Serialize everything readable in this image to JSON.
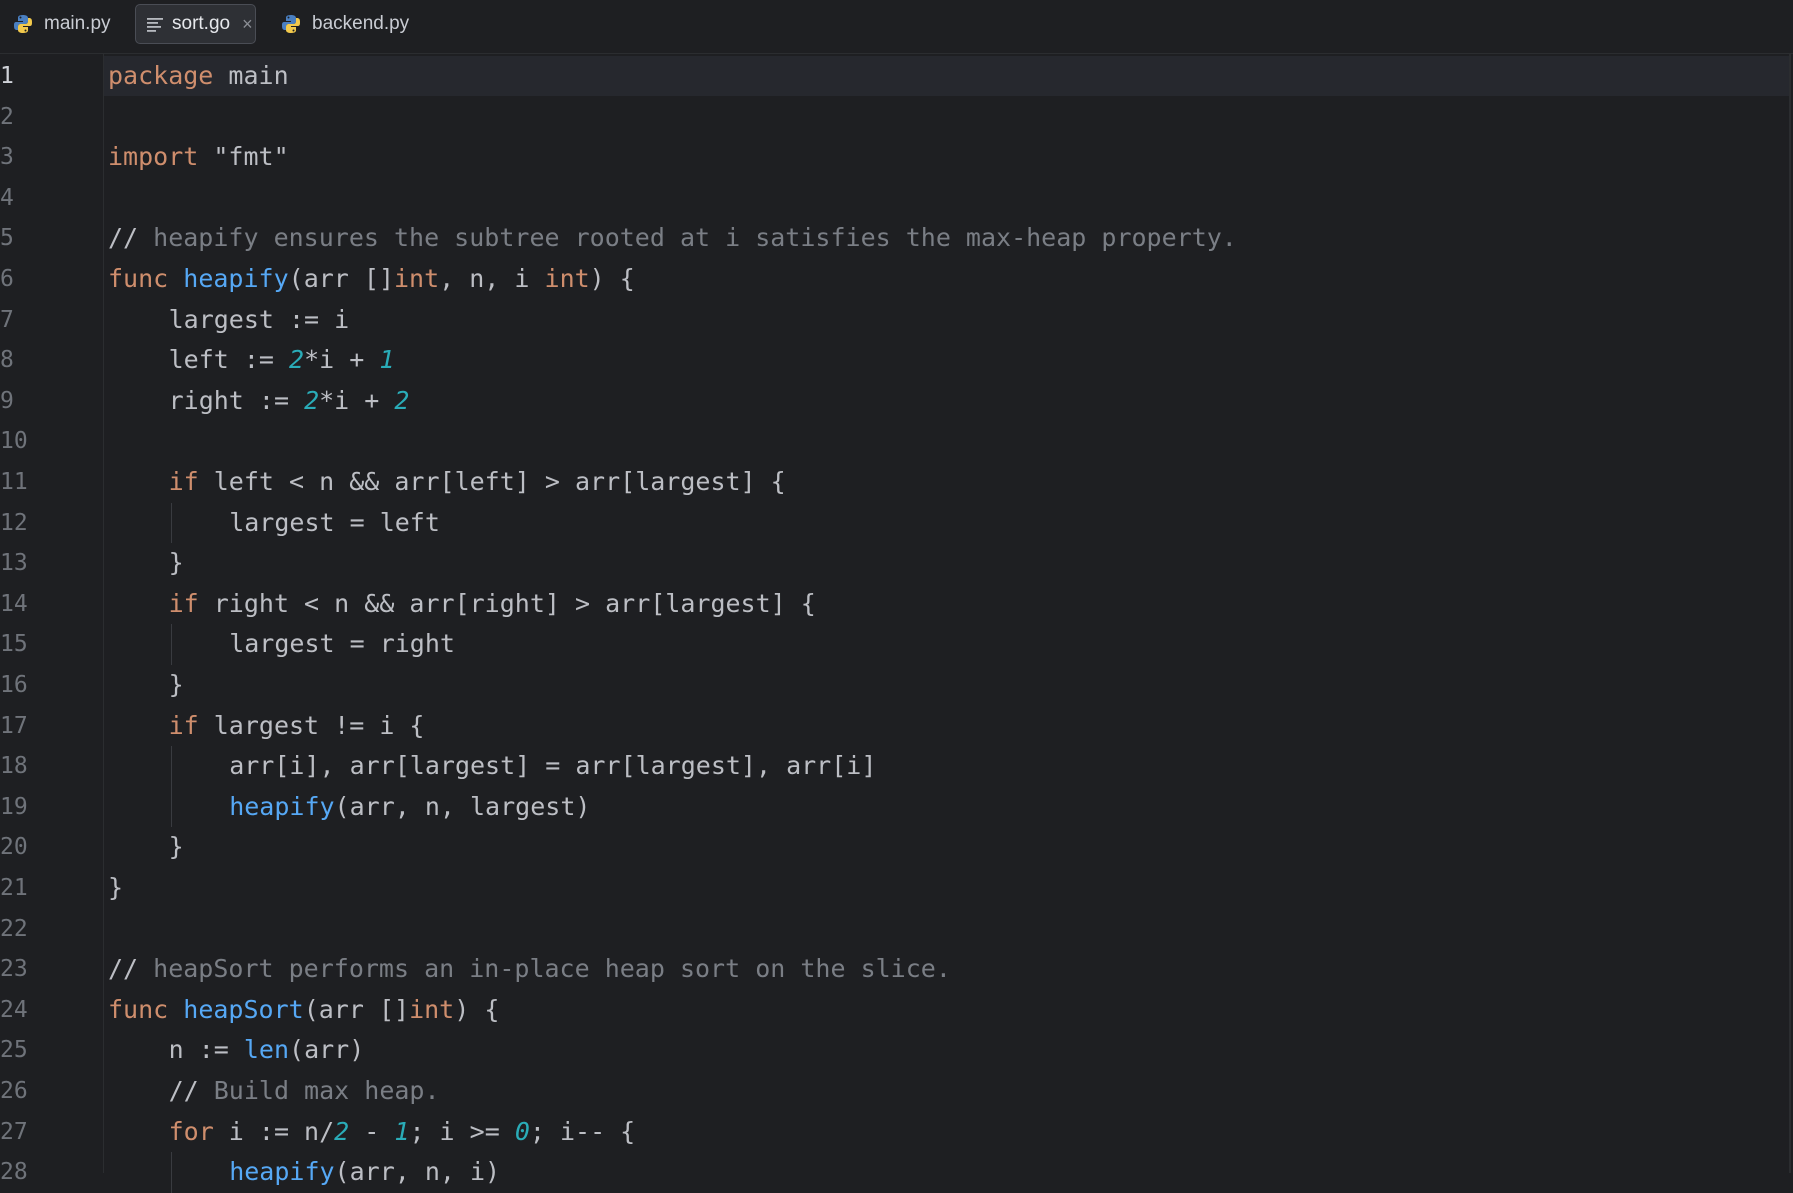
{
  "tabs": [
    {
      "label": "main.py",
      "icon": "python-icon",
      "active": false
    },
    {
      "label": "sort.go",
      "icon": "text-file-icon",
      "active": true,
      "close": "×"
    },
    {
      "label": "backend.py",
      "icon": "python-icon",
      "active": false
    }
  ],
  "colors": {
    "background": "#1e1f22",
    "keyword": "#cf8e6d",
    "function": "#56a8f5",
    "number": "#2aacb8",
    "comment": "#7a7e85",
    "text": "#bcbec4"
  },
  "editor": {
    "current_line": 1,
    "lines": [
      {
        "n": "1",
        "indent": 0,
        "tokens": [
          [
            "kw",
            "package"
          ],
          [
            "t",
            " main"
          ]
        ]
      },
      {
        "n": "2",
        "indent": 0,
        "tokens": []
      },
      {
        "n": "3",
        "indent": 0,
        "tokens": [
          [
            "kw",
            "import"
          ],
          [
            "t",
            " \"fmt\""
          ]
        ]
      },
      {
        "n": "4",
        "indent": 0,
        "tokens": []
      },
      {
        "n": "5",
        "indent": 0,
        "tokens": [
          [
            "t",
            "// "
          ],
          [
            "cm",
            "heapify ensures the subtree rooted at i satisfies the max-heap property."
          ]
        ]
      },
      {
        "n": "6",
        "indent": 0,
        "tokens": [
          [
            "kw",
            "func"
          ],
          [
            "t",
            " "
          ],
          [
            "fn",
            "heapify"
          ],
          [
            "t",
            "(arr []"
          ],
          [
            "kw",
            "int"
          ],
          [
            "t",
            ", n, i "
          ],
          [
            "kw",
            "int"
          ],
          [
            "t",
            ") {"
          ]
        ]
      },
      {
        "n": "7",
        "indent": 1,
        "tokens": [
          [
            "t",
            "largest := i"
          ]
        ]
      },
      {
        "n": "8",
        "indent": 1,
        "tokens": [
          [
            "t",
            "left := "
          ],
          [
            "num",
            "2"
          ],
          [
            "t",
            "*i + "
          ],
          [
            "num",
            "1"
          ]
        ]
      },
      {
        "n": "9",
        "indent": 1,
        "tokens": [
          [
            "t",
            "right := "
          ],
          [
            "num",
            "2"
          ],
          [
            "t",
            "*i + "
          ],
          [
            "num",
            "2"
          ]
        ]
      },
      {
        "n": "10",
        "indent": 0,
        "tokens": []
      },
      {
        "n": "11",
        "indent": 1,
        "tokens": [
          [
            "kw",
            "if"
          ],
          [
            "t",
            " left < n && arr[left] > arr[largest] {"
          ]
        ]
      },
      {
        "n": "12",
        "indent": 2,
        "tokens": [
          [
            "t",
            "largest = left"
          ]
        ]
      },
      {
        "n": "13",
        "indent": 1,
        "tokens": [
          [
            "t",
            "}"
          ]
        ]
      },
      {
        "n": "14",
        "indent": 1,
        "tokens": [
          [
            "kw",
            "if"
          ],
          [
            "t",
            " right < n && arr[right] > arr[largest] {"
          ]
        ]
      },
      {
        "n": "15",
        "indent": 2,
        "tokens": [
          [
            "t",
            "largest = right"
          ]
        ]
      },
      {
        "n": "16",
        "indent": 1,
        "tokens": [
          [
            "t",
            "}"
          ]
        ]
      },
      {
        "n": "17",
        "indent": 1,
        "tokens": [
          [
            "kw",
            "if"
          ],
          [
            "t",
            " largest != i {"
          ]
        ]
      },
      {
        "n": "18",
        "indent": 2,
        "tokens": [
          [
            "t",
            "arr[i], arr[largest] = arr[largest], arr[i]"
          ]
        ]
      },
      {
        "n": "19",
        "indent": 2,
        "tokens": [
          [
            "fn",
            "heapify"
          ],
          [
            "t",
            "(arr, n, largest)"
          ]
        ]
      },
      {
        "n": "20",
        "indent": 1,
        "tokens": [
          [
            "t",
            "}"
          ]
        ]
      },
      {
        "n": "21",
        "indent": 0,
        "tokens": [
          [
            "t",
            "}"
          ]
        ]
      },
      {
        "n": "22",
        "indent": 0,
        "tokens": []
      },
      {
        "n": "23",
        "indent": 0,
        "tokens": [
          [
            "t",
            "// "
          ],
          [
            "cm",
            "heapSort performs an in-place heap sort on the slice."
          ]
        ]
      },
      {
        "n": "24",
        "indent": 0,
        "tokens": [
          [
            "kw",
            "func"
          ],
          [
            "t",
            " "
          ],
          [
            "fn",
            "heapSort"
          ],
          [
            "t",
            "(arr []"
          ],
          [
            "kw",
            "int"
          ],
          [
            "t",
            ") {"
          ]
        ]
      },
      {
        "n": "25",
        "indent": 1,
        "tokens": [
          [
            "t",
            "n := "
          ],
          [
            "fn",
            "len"
          ],
          [
            "t",
            "(arr)"
          ]
        ]
      },
      {
        "n": "26",
        "indent": 1,
        "tokens": [
          [
            "t",
            "// "
          ],
          [
            "cm",
            "Build max heap."
          ]
        ]
      },
      {
        "n": "27",
        "indent": 1,
        "tokens": [
          [
            "kw",
            "for"
          ],
          [
            "t",
            " i := n/"
          ],
          [
            "num",
            "2"
          ],
          [
            "t",
            " - "
          ],
          [
            "num",
            "1"
          ],
          [
            "t",
            "; i >= "
          ],
          [
            "num",
            "0"
          ],
          [
            "t",
            "; i-- {"
          ]
        ]
      },
      {
        "n": "28",
        "indent": 2,
        "tokens": [
          [
            "fn",
            "heapify"
          ],
          [
            "t",
            "(arr, n, i)"
          ]
        ]
      }
    ]
  }
}
